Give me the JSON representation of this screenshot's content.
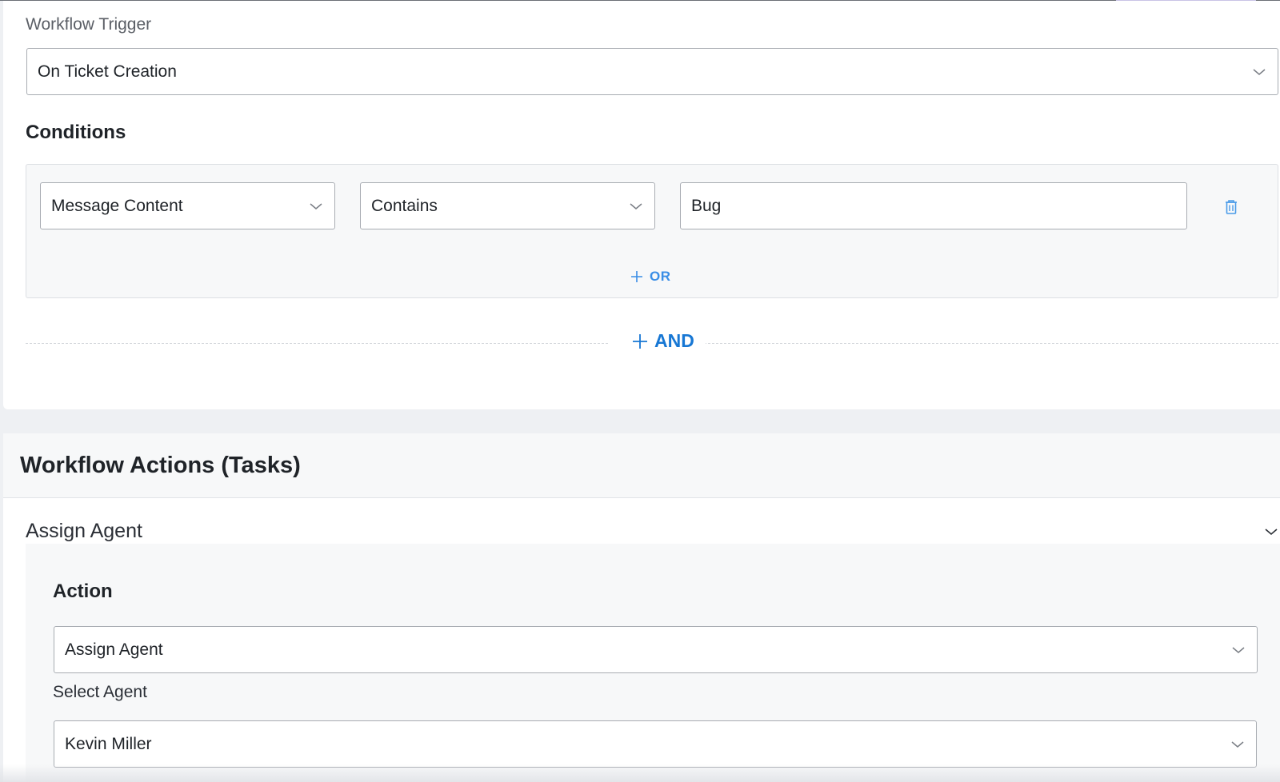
{
  "trigger": {
    "label": "Workflow Trigger",
    "value": "On Ticket Creation"
  },
  "conditions": {
    "title": "Conditions",
    "rows": [
      {
        "field": "Message Content",
        "operator": "Contains",
        "value": "Bug"
      }
    ],
    "or_label": "OR",
    "and_label": "AND"
  },
  "actions": {
    "title": "Workflow Actions (Tasks)",
    "item_title": "Assign Agent",
    "action_heading": "Action",
    "action_value": "Assign Agent",
    "agent_label": "Select Agent",
    "agent_value": "Kevin Miller"
  },
  "colors": {
    "accent_blue": "#1777d4",
    "or_blue": "#3a8ee6",
    "trash_blue": "#4a9be8"
  },
  "icons": [
    "chevron-down-icon",
    "trash-icon",
    "plus-icon"
  ]
}
